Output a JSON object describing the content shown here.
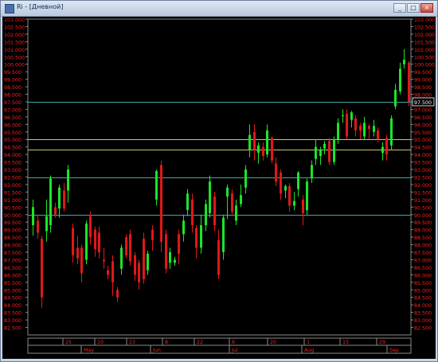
{
  "window": {
    "title": "Ri - [Дневной]",
    "minimize_glyph": "_",
    "restore_glyph": "□",
    "close_glyph": "×"
  },
  "colors": {
    "background": "#000000",
    "axis_label": "#ff2020",
    "up_candle": "#19e62a",
    "down_candle": "#e01818",
    "hline_blue": "#3fa8a8",
    "hline_yellow": "#c8c870",
    "frame": "#8a8a8a"
  },
  "chart_data": {
    "type": "candlestick",
    "ylim": [
      82000,
      103000
    ],
    "y_ticks": [
      "103.000",
      "102.500",
      "102.000",
      "101.500",
      "101.000",
      "100.500",
      "100.000",
      "99.500",
      "99.000",
      "98.500",
      "98.000",
      "97.500",
      "97.000",
      "96.500",
      "96.000",
      "95.500",
      "95.000",
      "94.500",
      "94.000",
      "93.500",
      "93.000",
      "92.500",
      "92.000",
      "91.500",
      "91.000",
      "90.500",
      "90.000",
      "89.500",
      "89.000",
      "88.500",
      "88.000",
      "87.500",
      "87.000",
      "86.500",
      "86.000",
      "85.500",
      "85.000",
      "84.500",
      "84.000",
      "83.500",
      "83.000",
      "82.500"
    ],
    "current_price_label": "97.500",
    "horizontal_lines": [
      {
        "value": 97500,
        "color": "blue"
      },
      {
        "value": 95000,
        "color": "yellow"
      },
      {
        "value": 94300,
        "color": "yellow"
      },
      {
        "value": 92500,
        "color": "blue"
      },
      {
        "value": 90000,
        "color": "blue"
      }
    ],
    "candles": [
      [
        89300,
        90500,
        88600,
        91000
      ],
      [
        89600,
        88800,
        88400,
        90000
      ],
      [
        88400,
        84500,
        83800,
        88600
      ],
      [
        88900,
        89900,
        88200,
        91000
      ],
      [
        89300,
        92400,
        88800,
        92600
      ],
      [
        90500,
        90000,
        89800,
        90800
      ],
      [
        90400,
        91800,
        89800,
        92000
      ],
      [
        91600,
        90400,
        90200,
        92100
      ],
      [
        91600,
        93000,
        90800,
        93300
      ],
      [
        89100,
        87300,
        86800,
        89400
      ],
      [
        87800,
        87100,
        86700,
        88600
      ],
      [
        87800,
        86100,
        85500,
        88000
      ],
      [
        87000,
        89400,
        86700,
        89600
      ],
      [
        89900,
        88500,
        88000,
        90200
      ],
      [
        89000,
        87700,
        87200,
        89200
      ],
      [
        88800,
        87500,
        87100,
        89200
      ],
      [
        87000,
        86900,
        86400,
        87800
      ],
      [
        86300,
        86000,
        85700,
        86600
      ],
      [
        86900,
        85500,
        84600,
        87300
      ],
      [
        85000,
        84500,
        84200,
        85200
      ],
      [
        86400,
        87800,
        86000,
        88000
      ],
      [
        88500,
        87300,
        87100,
        88700
      ],
      [
        88700,
        86900,
        86600,
        89000
      ],
      [
        87300,
        86000,
        85600,
        87500
      ],
      [
        86800,
        85500,
        85000,
        87000
      ],
      [
        88400,
        85700,
        85400,
        88800
      ],
      [
        86300,
        87400,
        86000,
        87600
      ],
      [
        89000,
        88300,
        87600,
        89300
      ],
      [
        91000,
        92900,
        90600,
        93000
      ],
      [
        93300,
        88200,
        87500,
        93600
      ],
      [
        88700,
        86400,
        86100,
        89000
      ],
      [
        86800,
        87500,
        86400,
        87800
      ],
      [
        86800,
        87000,
        86600,
        87200
      ],
      [
        88700,
        87400,
        86700,
        89000
      ],
      [
        88700,
        89600,
        88200,
        90000
      ],
      [
        90300,
        91400,
        89900,
        91700
      ],
      [
        91000,
        89300,
        88800,
        91400
      ],
      [
        89100,
        87800,
        87100,
        89300
      ],
      [
        87800,
        89300,
        87400,
        90000
      ],
      [
        89300,
        90700,
        88900,
        91000
      ],
      [
        90100,
        92200,
        89800,
        92600
      ],
      [
        91200,
        89300,
        88900,
        91500
      ],
      [
        88300,
        86000,
        85700,
        89000
      ],
      [
        87500,
        89800,
        87000,
        90000
      ],
      [
        91200,
        91800,
        89700,
        92000
      ],
      [
        91400,
        90200,
        89900,
        91700
      ],
      [
        89600,
        90600,
        89300,
        91000
      ],
      [
        90700,
        91300,
        90500,
        92000
      ],
      [
        91800,
        93000,
        91400,
        93300
      ],
      [
        94300,
        95300,
        93800,
        96000
      ],
      [
        95500,
        94300,
        93600,
        96000
      ],
      [
        94100,
        94600,
        93400,
        94800
      ],
      [
        94500,
        93900,
        93600,
        94800
      ],
      [
        94000,
        95600,
        93800,
        96000
      ],
      [
        95100,
        93600,
        93400,
        95200
      ],
      [
        93400,
        92200,
        91900,
        93800
      ],
      [
        92800,
        91400,
        91000,
        93000
      ],
      [
        91600,
        91900,
        91100,
        92000
      ],
      [
        91900,
        90600,
        90200,
        92100
      ],
      [
        90600,
        90900,
        90300,
        91500
      ],
      [
        91700,
        92800,
        91200,
        92900
      ],
      [
        91000,
        90100,
        89300,
        91300
      ],
      [
        90300,
        92200,
        90000,
        92400
      ],
      [
        92400,
        93300,
        92100,
        93600
      ],
      [
        93700,
        94500,
        93300,
        95000
      ],
      [
        93900,
        94300,
        93300,
        94500
      ],
      [
        94400,
        94700,
        94000,
        94900
      ],
      [
        94900,
        93500,
        93300,
        95100
      ],
      [
        93500,
        95000,
        93300,
        95200
      ],
      [
        95000,
        96100,
        94700,
        96400
      ],
      [
        96600,
        96600,
        96100,
        97000
      ],
      [
        96700,
        95200,
        95000,
        97000
      ],
      [
        96300,
        96800,
        95800,
        96900
      ],
      [
        96400,
        95600,
        95200,
        96600
      ],
      [
        95900,
        95600,
        95000,
        96100
      ],
      [
        95200,
        96100,
        95000,
        96500
      ],
      [
        95900,
        95700,
        95000,
        96000
      ],
      [
        95500,
        95900,
        95200,
        96300
      ],
      [
        95600,
        95000,
        94800,
        95800
      ],
      [
        94100,
        94500,
        93600,
        94800
      ],
      [
        95100,
        94000,
        93600,
        95300
      ],
      [
        94600,
        96400,
        94300,
        96600
      ],
      [
        97200,
        98300,
        97000,
        98700
      ],
      [
        98200,
        99700,
        98000,
        100100
      ],
      [
        100000,
        100300,
        99700,
        101000
      ],
      [
        100100,
        97500,
        97200,
        100200
      ]
    ],
    "x_axis": {
      "upper_labels": [
        "25",
        "10",
        "23",
        "8",
        "22",
        "6",
        "20",
        "1",
        "15",
        "29"
      ],
      "lower_labels": [
        "May",
        "Jun",
        "Jul",
        "Aug",
        "Sep"
      ]
    }
  }
}
